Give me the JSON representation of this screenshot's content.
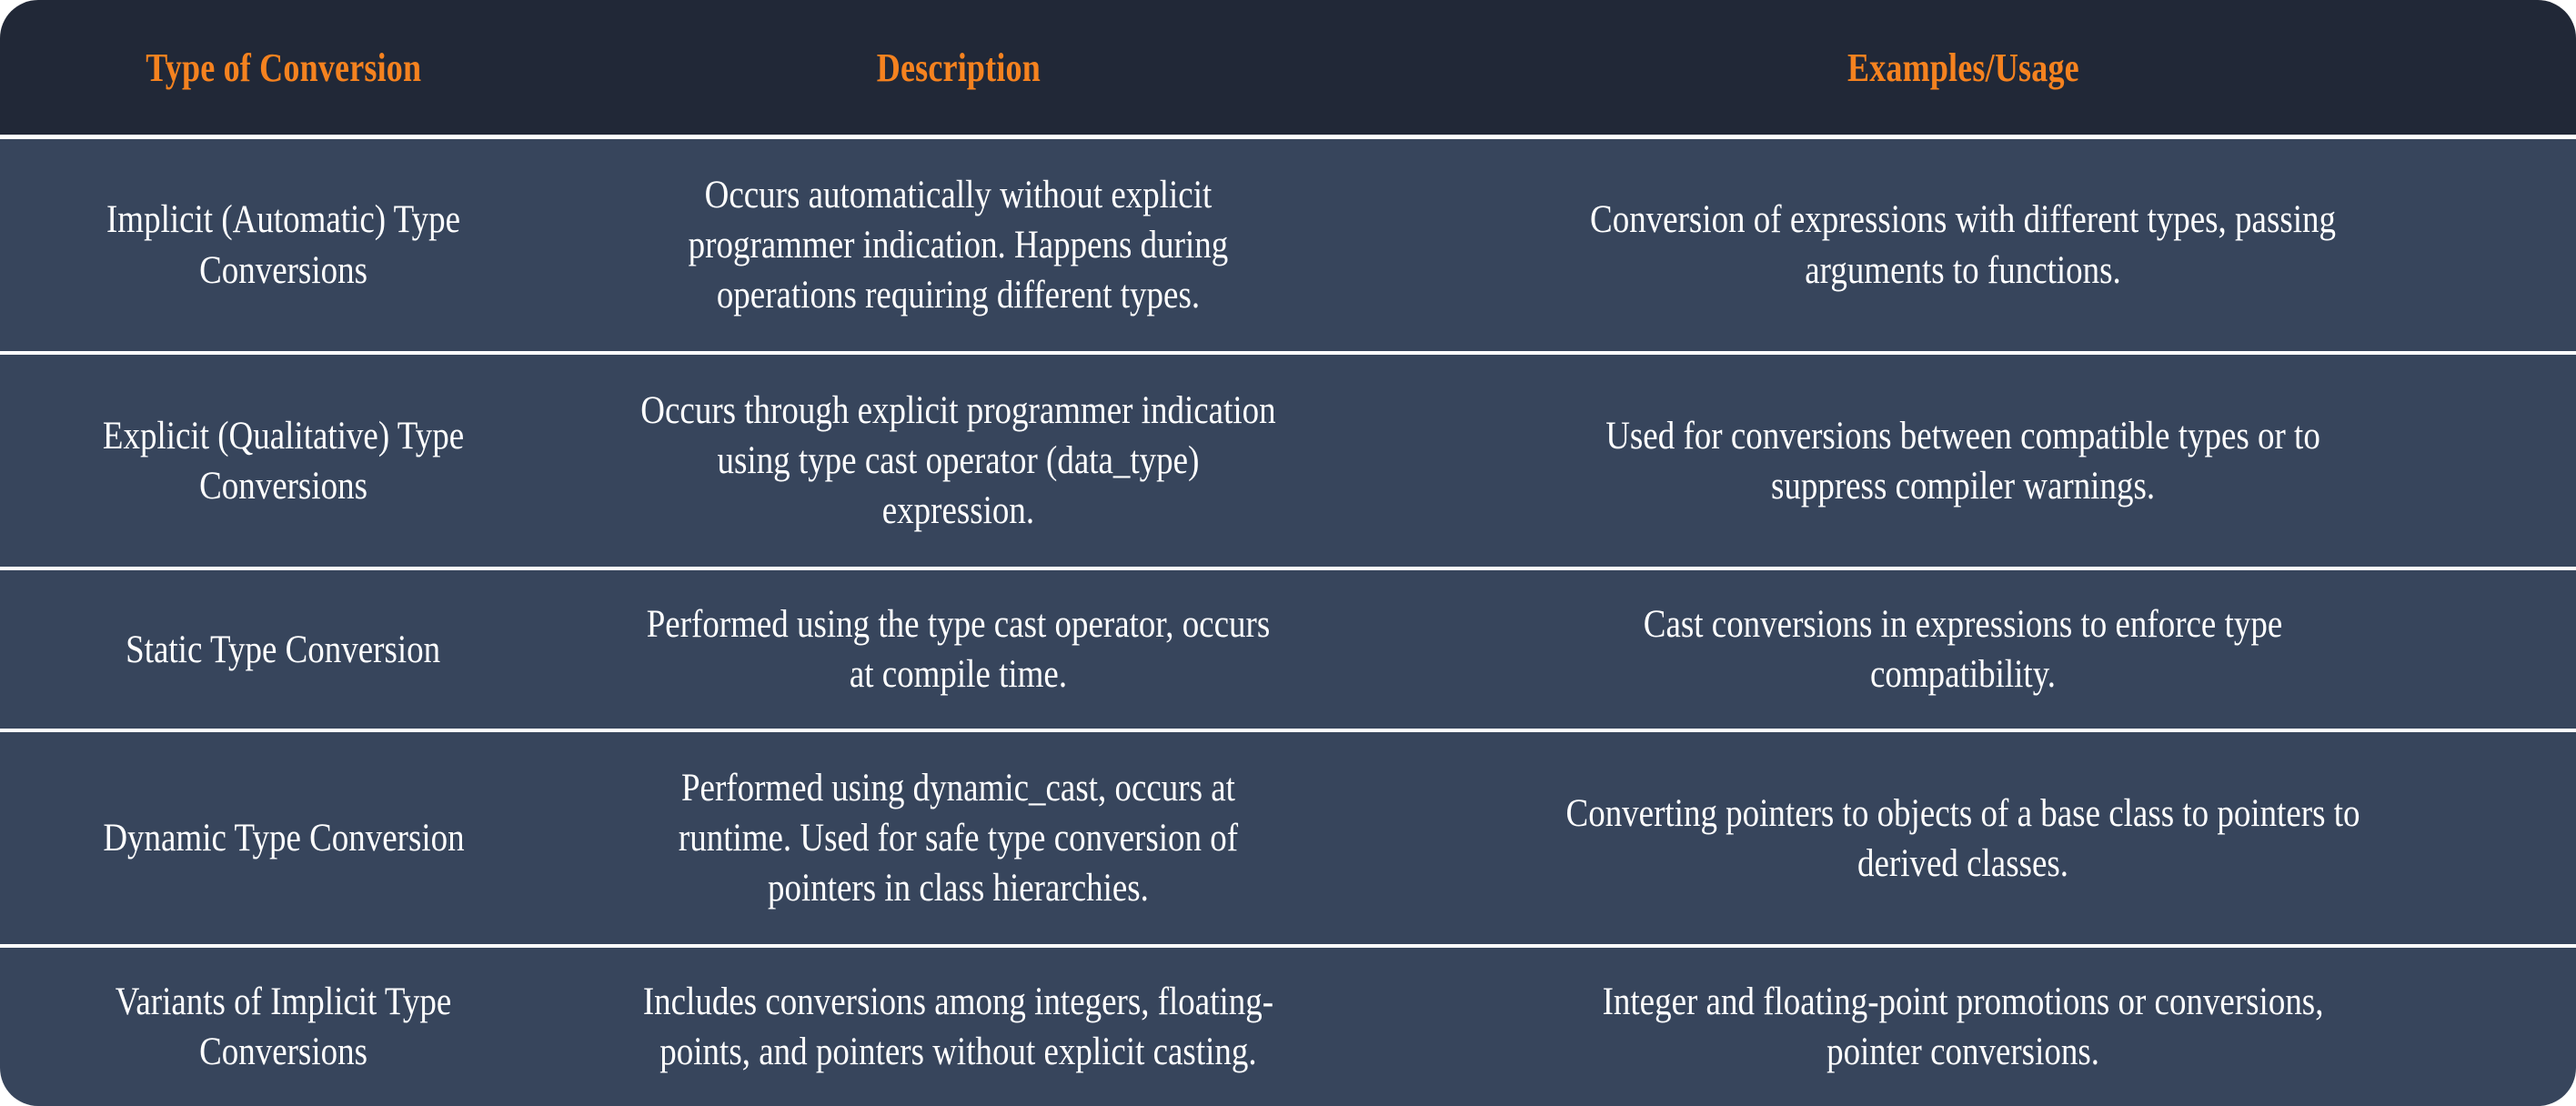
{
  "table": {
    "columns": [
      {
        "key": "type",
        "label": "Type of Conversion"
      },
      {
        "key": "desc",
        "label": "Description"
      },
      {
        "key": "usage",
        "label": "Examples/Usage"
      }
    ],
    "rows": [
      {
        "type": "Implicit (Automatic) Type Conversions",
        "desc": "Occurs automatically without explicit programmer indication. Happens during operations requiring different types.",
        "usage": "Conversion of expressions with different types, passing arguments to functions."
      },
      {
        "type": "Explicit (Qualitative) Type Conversions",
        "desc": "Occurs through explicit programmer indication using type cast operator (data_type) expression.",
        "usage": "Used for conversions between compatible types or to suppress compiler warnings."
      },
      {
        "type": "Static Type Conversion",
        "desc": "Performed using the type cast operator, occurs at compile time.",
        "usage": "Cast conversions in expressions to enforce type compatibility."
      },
      {
        "type": "Dynamic Type Conversion",
        "desc": "Performed using dynamic_cast, occurs at runtime. Used for safe type conversion of pointers in class hierarchies.",
        "usage": "Converting pointers to objects of a base class to pointers to derived classes."
      },
      {
        "type": "Variants of Implicit Type Conversions",
        "desc": "Includes conversions among integers, floating-points, and pointers without explicit casting.",
        "usage": "Integer and floating-point promotions or conversions, pointer conversions."
      }
    ]
  },
  "colors": {
    "header_background": "#212837",
    "header_text": "#f5821f",
    "row_background": "#37455c",
    "row_text": "#ffffff",
    "divider": "#ffffff",
    "page_background": "#ffffff"
  }
}
